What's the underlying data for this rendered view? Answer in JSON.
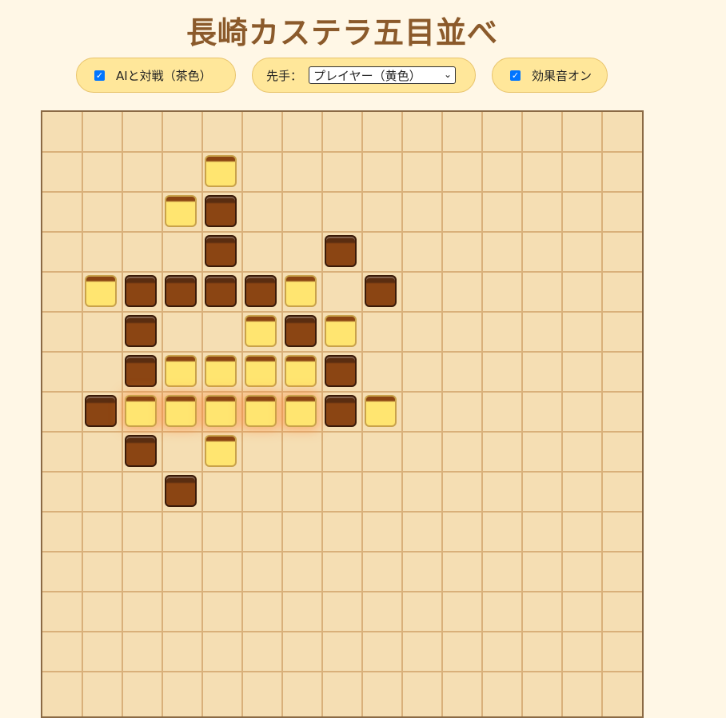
{
  "title": "長崎カステラ五目並べ",
  "controls": {
    "ai_label": "AIと対戦（茶色）",
    "ai_checked": true,
    "first_label": "先手：",
    "first_selected": "プレイヤー（黄色）",
    "sound_label": "効果音オン",
    "sound_checked": true
  },
  "board": {
    "size": 15,
    "colors": {
      "board_bg": "#f5deb3",
      "grid": "#d9b07a",
      "brown_piece": "#8b4513",
      "yellow_piece": "#ffe570"
    },
    "pieces": [
      {
        "row": 1,
        "col": 4,
        "color": "yellow"
      },
      {
        "row": 2,
        "col": 3,
        "color": "yellow"
      },
      {
        "row": 2,
        "col": 4,
        "color": "brown"
      },
      {
        "row": 3,
        "col": 4,
        "color": "brown"
      },
      {
        "row": 3,
        "col": 7,
        "color": "brown"
      },
      {
        "row": 4,
        "col": 1,
        "color": "yellow"
      },
      {
        "row": 4,
        "col": 2,
        "color": "brown"
      },
      {
        "row": 4,
        "col": 3,
        "color": "brown"
      },
      {
        "row": 4,
        "col": 4,
        "color": "brown"
      },
      {
        "row": 4,
        "col": 5,
        "color": "brown"
      },
      {
        "row": 4,
        "col": 6,
        "color": "yellow"
      },
      {
        "row": 4,
        "col": 8,
        "color": "brown"
      },
      {
        "row": 5,
        "col": 2,
        "color": "brown"
      },
      {
        "row": 5,
        "col": 5,
        "color": "yellow"
      },
      {
        "row": 5,
        "col": 6,
        "color": "brown"
      },
      {
        "row": 5,
        "col": 7,
        "color": "yellow"
      },
      {
        "row": 6,
        "col": 2,
        "color": "brown"
      },
      {
        "row": 6,
        "col": 3,
        "color": "yellow"
      },
      {
        "row": 6,
        "col": 4,
        "color": "yellow"
      },
      {
        "row": 6,
        "col": 5,
        "color": "yellow"
      },
      {
        "row": 6,
        "col": 6,
        "color": "yellow"
      },
      {
        "row": 6,
        "col": 7,
        "color": "brown"
      },
      {
        "row": 7,
        "col": 1,
        "color": "brown"
      },
      {
        "row": 7,
        "col": 2,
        "color": "yellow",
        "win": true
      },
      {
        "row": 7,
        "col": 3,
        "color": "yellow",
        "win": true
      },
      {
        "row": 7,
        "col": 4,
        "color": "yellow",
        "win": true
      },
      {
        "row": 7,
        "col": 5,
        "color": "yellow",
        "win": true
      },
      {
        "row": 7,
        "col": 6,
        "color": "yellow",
        "win": true
      },
      {
        "row": 7,
        "col": 7,
        "color": "brown"
      },
      {
        "row": 7,
        "col": 8,
        "color": "yellow"
      },
      {
        "row": 8,
        "col": 2,
        "color": "brown"
      },
      {
        "row": 8,
        "col": 4,
        "color": "yellow"
      },
      {
        "row": 9,
        "col": 3,
        "color": "brown"
      }
    ]
  }
}
